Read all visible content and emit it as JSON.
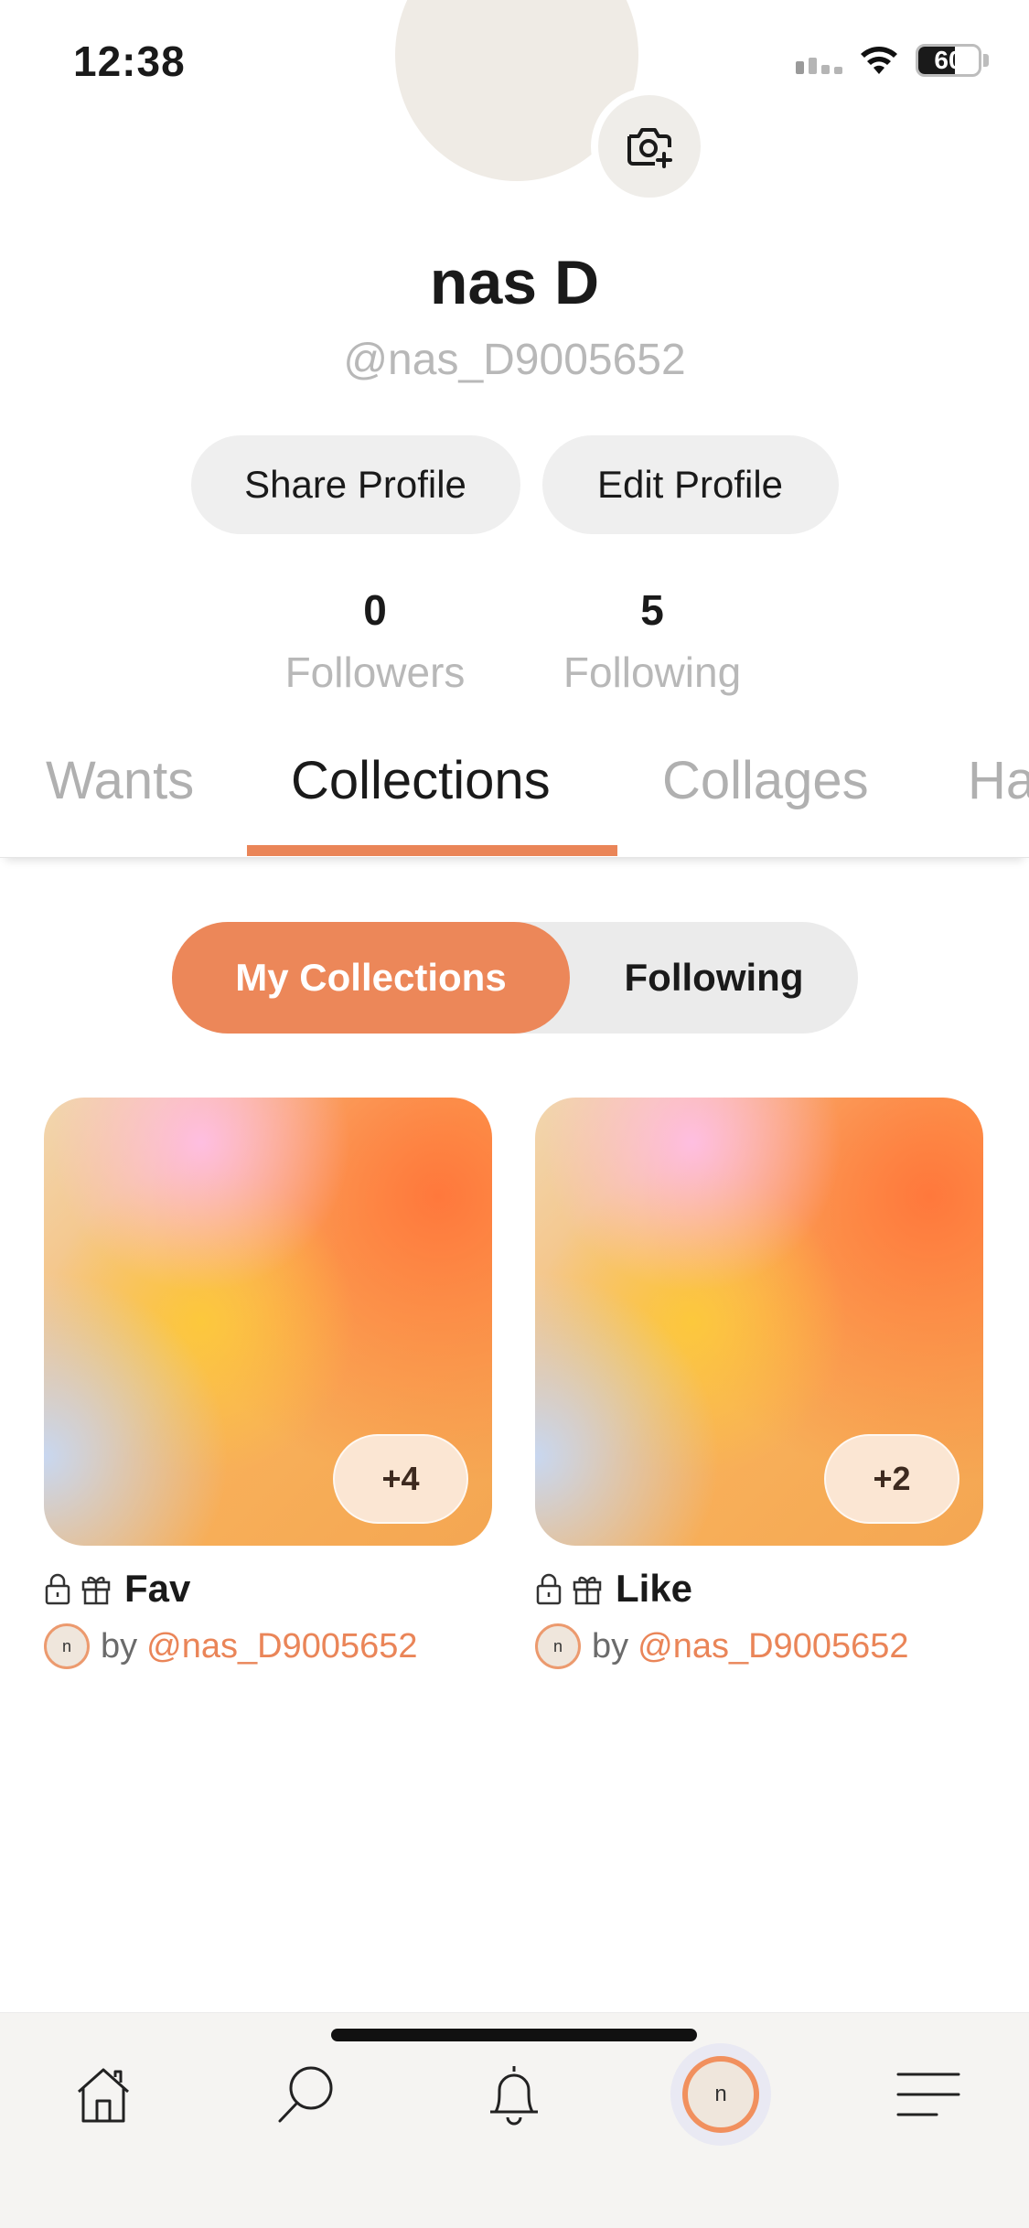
{
  "status_bar": {
    "time": "12:38",
    "battery": "60",
    "battery_level": 0.6,
    "icons": [
      "signal-icon",
      "wifi-icon",
      "battery-icon"
    ]
  },
  "profile": {
    "display_name": "nas D",
    "username": "@nas_D9005652",
    "share_label": "Share Profile",
    "edit_label": "Edit Profile",
    "followers_count": "0",
    "followers_label": "Followers",
    "following_count": "5",
    "following_label": "Following"
  },
  "tabs": [
    {
      "label": "Wants",
      "active": false
    },
    {
      "label": "Collections",
      "active": true
    },
    {
      "label": "Collages",
      "active": false
    },
    {
      "label": "Ha",
      "active": false
    }
  ],
  "segmented": {
    "mine_label": "My Collections",
    "following_label": "Following",
    "selected": "My Collections"
  },
  "collections": [
    {
      "title": "Fav",
      "count": "+4",
      "by": "by",
      "handle": "@nas_D9005652",
      "avatar_initial": "n"
    },
    {
      "title": "Like",
      "count": "+2",
      "by": "by",
      "handle": "@nas_D9005652",
      "avatar_initial": "n"
    }
  ],
  "bottom_nav": {
    "items": [
      "home-icon",
      "search-icon",
      "bell-icon",
      "profile-avatar",
      "menu-icon"
    ],
    "profile_initial": "n",
    "active": "profile-avatar"
  },
  "colors": {
    "accent": "#ea8558",
    "muted_text": "#b8b8b8",
    "pill_bg": "#efefef"
  }
}
